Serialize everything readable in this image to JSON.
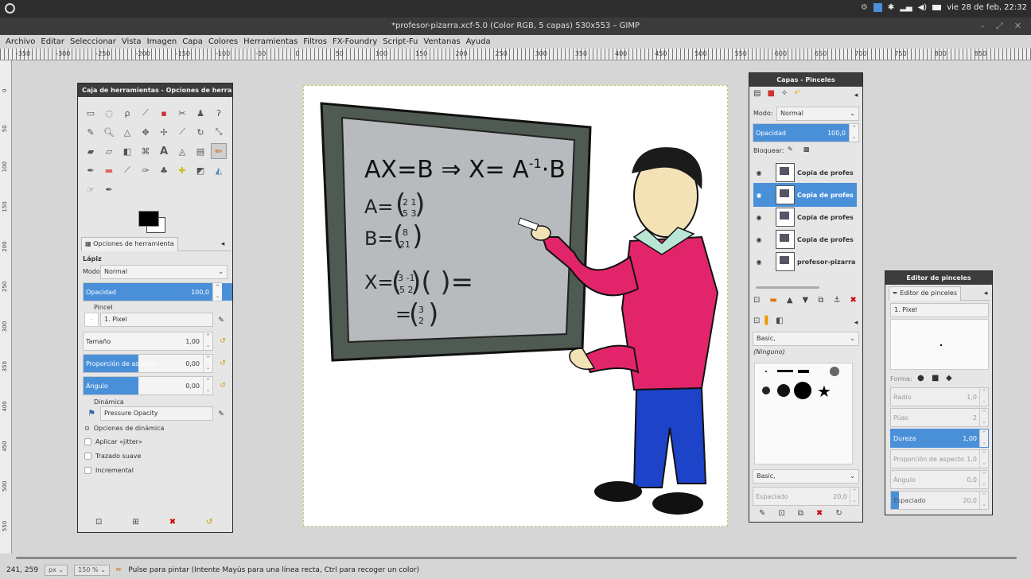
{
  "topbar": {
    "datetime": "vie 28 de feb, 22:32"
  },
  "window": {
    "title": "*profesor-pizarra.xcf-5.0 (Color RGB, 5 capas) 530x553 – GIMP",
    "controls": [
      "–",
      "⤢",
      "✕"
    ]
  },
  "menu": [
    "Archivo",
    "Editar",
    "Seleccionar",
    "Vista",
    "Imagen",
    "Capa",
    "Colores",
    "Herramientas",
    "Filtros",
    "FX-Foundry",
    "Script-Fu",
    "Ventanas",
    "Ayuda"
  ],
  "ruler": {
    "h_labels": [
      "-350",
      "-300",
      "-250",
      "-200",
      "-150",
      "-100",
      "-50",
      "0",
      "50",
      "100",
      "150",
      "200",
      "250",
      "300",
      "350",
      "400",
      "450",
      "500",
      "550",
      "600",
      "650",
      "700",
      "750",
      "800",
      "850"
    ],
    "v_labels": [
      "0",
      "50",
      "100",
      "150",
      "200",
      "250",
      "300",
      "350",
      "400",
      "450",
      "500",
      "550"
    ]
  },
  "toolbox": {
    "title": "Caja de herramientas - Opciones de herramienta",
    "tab_label": "Opciones de herramienta",
    "tool_name": "Lápiz",
    "mode_label": "Modo:",
    "mode_value": "Normal",
    "opacity_label": "Opacidad",
    "opacity_value": "100,0",
    "opacity_fraction": 1.0,
    "brush_label": "Pincel",
    "brush_value": "1. Pixel",
    "size_label": "Tamaño",
    "size_value": "1,00",
    "aspect_label": "Proporción de aspecto",
    "aspect_value": "0,00",
    "aspect_fraction": 0.42,
    "angle_label": "Ángulo",
    "angle_value": "0,00",
    "angle_fraction": 0.42,
    "dynamics_label": "Dinámica",
    "dynamics_value": "Pressure Opacity",
    "dyn_options": "Opciones de dinámica",
    "jitter": "Aplicar «jitter»",
    "smooth": "Trazado suave",
    "incremental": "Incremental"
  },
  "layers": {
    "title": "Capas - Pinceles",
    "mode_label": "Modo:",
    "mode_value": "Normal",
    "opacity_label": "Opacidad",
    "opacity_value": "100,0",
    "lock_label": "Bloquear:",
    "items": [
      {
        "name": "Copia de profes",
        "selected": false
      },
      {
        "name": "Copia de profes",
        "selected": true
      },
      {
        "name": "Copia de profes",
        "selected": false
      },
      {
        "name": "Copia de profes",
        "selected": false
      },
      {
        "name": "profesor-pizarra",
        "selected": false
      }
    ],
    "brush_set": "Basic,",
    "brush_tag": "(Ninguno)",
    "brush_set2": "Basic,",
    "spacing_label": "Espaciado",
    "spacing_value": "20,0"
  },
  "brush_editor": {
    "title": "Editor de pinceles",
    "tab_label": "Editor de pinceles",
    "brush_name": "1. Pixel",
    "shape_label": "Forma:",
    "radius_label": "Radio",
    "radius_value": "1,0",
    "spikes_label": "Púas",
    "spikes_value": "2",
    "hardness_label": "Dureza",
    "hardness_value": "1,00",
    "aspect_label": "Proporción de aspecto",
    "aspect_value": "1,0",
    "angle_label": "Ángulo",
    "angle_value": "0,0",
    "spacing_label": "Espaciado",
    "spacing_value": "20,0",
    "spacing_fraction": 0.08
  },
  "board": {
    "line1": "AX=B ⇒ X= A",
    "exp": "-1",
    "line1b": "·B",
    "a_label": "A=",
    "b_label": "B=",
    "x_label": "X=",
    "eq2": "="
  },
  "status": {
    "coords": "241, 259",
    "unit": "px",
    "zoom": "150 %",
    "message": "Pulse para pintar (Intente Mayús para una línea recta, Ctrl para recoger un color)"
  }
}
